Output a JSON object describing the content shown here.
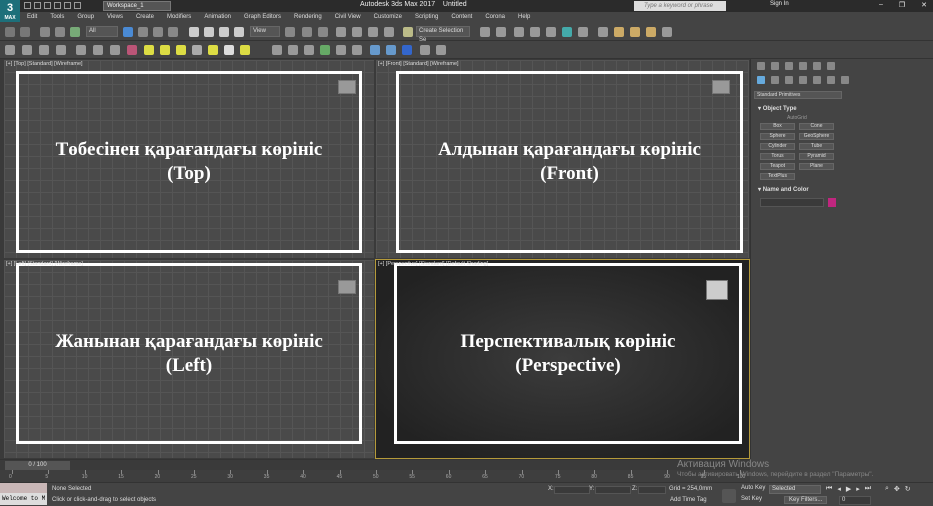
{
  "app": {
    "logo": "3",
    "logo_sub": "MAX",
    "workspace": "Workspace_1",
    "title": "Autodesk 3ds Max 2017",
    "doc": "Untitled",
    "search_placeholder": "Type a keyword or phrase",
    "sign_in": "Sign In"
  },
  "menu": [
    "Edit",
    "Tools",
    "Group",
    "Views",
    "Create",
    "Modifiers",
    "Animation",
    "Graph Editors",
    "Rendering",
    "Civil View",
    "Customize",
    "Scripting",
    "Content",
    "Corona",
    "Help"
  ],
  "toolbar": {
    "filter": "All",
    "view": "View",
    "selection_set": "Create Selection Se"
  },
  "viewports": [
    {
      "label": "[+] [Top] [Standard] [Wireframe]",
      "caption_line1": "Төбесінен қарағандағы көрініс",
      "caption_line2": "(Top)"
    },
    {
      "label": "[+] [Front] [Standard] [Wireframe]",
      "caption_line1": "Алдынан қарағандағы көрініс",
      "caption_line2": "(Front)"
    },
    {
      "label": "[+] [Left] [Standard] [Wireframe]",
      "caption_line1": "Жанынан қарағандағы көрініс",
      "caption_line2": "(Left)"
    },
    {
      "label": "[+] [Perspective] [Standard] [Default Shading]",
      "caption_line1": "Перспективалық көрініс",
      "caption_line2": "(Perspective)"
    }
  ],
  "command_panel": {
    "dropdown": "Standard Primitives",
    "object_type": "Object Type",
    "autogrid": "AutoGrid",
    "buttons": [
      "Box",
      "Cone",
      "Sphere",
      "GeoSphere",
      "Cylinder",
      "Tube",
      "Torus",
      "Pyramid",
      "Teapot",
      "Plane",
      "TextPlus"
    ],
    "name_color": "Name and Color",
    "swatch_color": "#c0267f"
  },
  "timeline": {
    "slider": "0 / 100",
    "ticks": [
      "0",
      "5",
      "10",
      "15",
      "20",
      "25",
      "30",
      "35",
      "40",
      "45",
      "50",
      "55",
      "60",
      "65",
      "70",
      "75",
      "80",
      "85",
      "90",
      "95",
      "100"
    ]
  },
  "status": {
    "maxscript": "Welcome to M",
    "selection": "None Selected",
    "prompt": "Click or click-and-drag to select objects",
    "x_label": "X:",
    "y_label": "Y:",
    "z_label": "Z:",
    "grid": "Grid = 254,0mm",
    "add_time_tag": "Add Time Tag",
    "auto_key": "Auto Key",
    "selected": "Selected",
    "set_key": "Set Key",
    "key_filters": "Key Filters...",
    "frame": "0"
  },
  "watermark": {
    "line1": "Активация Windows",
    "line2": "Чтобы активировать Windows, перейдите в раздел \"Параметры\"."
  }
}
